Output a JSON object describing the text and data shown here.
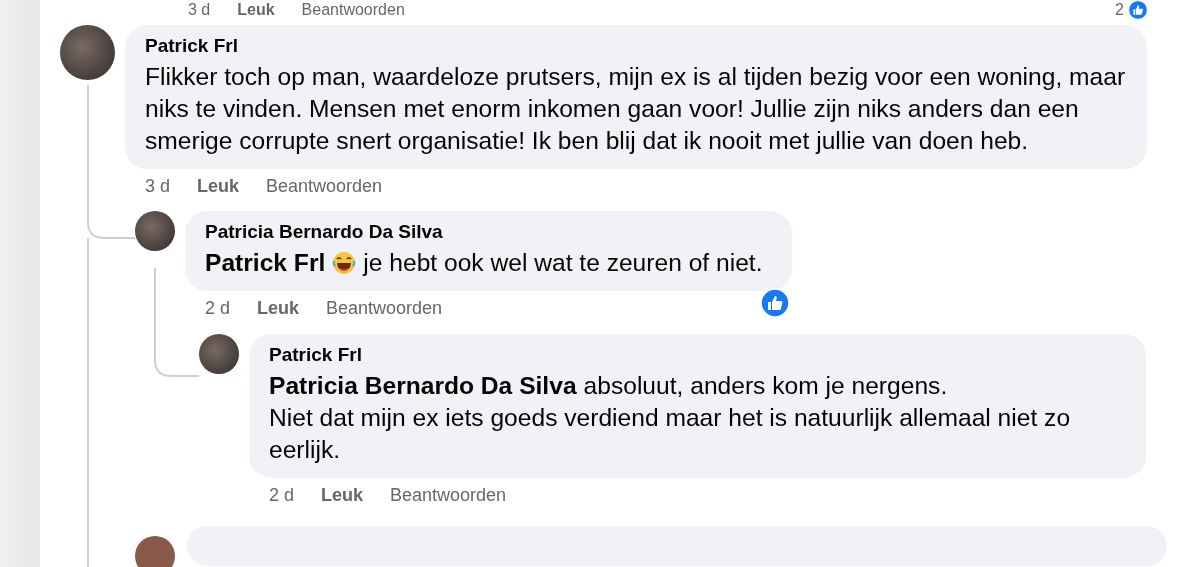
{
  "previous_actions": {
    "time": "3 d",
    "like": "Leuk",
    "reply": "Beantwoorden",
    "reaction_count": "2"
  },
  "comments": [
    {
      "author": "Patrick Frl",
      "emoji": false,
      "paragraphs": [
        "Flikker toch op man, waardeloze prutsers, mijn ex is al tijden bezig voor een woning, maar niks te vinden. Mensen met enorm inkomen gaan voor! Jullie zijn niks anders dan een smerige corrupte snert organisatie! Ik ben blij dat ik nooit met jullie van doen heb."
      ],
      "time": "3 d",
      "like": "Leuk",
      "reply": "Beantwoorden",
      "liked": false,
      "replies": [
        {
          "author": "Patricia Bernardo Da Silva",
          "mention": "Patrick Frl",
          "emoji": true,
          "paragraphs": [
            "je hebt ook wel wat te zeuren of niet."
          ],
          "time": "2 d",
          "like": "Leuk",
          "reply": "Beantwoorden",
          "liked": true,
          "replies": [
            {
              "author": "Patrick Frl",
              "mention": "Patricia Bernardo Da Silva",
              "emoji": false,
              "paragraphs": [
                "absoluut, anders kom je nergens.",
                "Niet dat mijn ex iets goeds verdiend maar het is natuurlijk allemaal niet zo eerlijk."
              ],
              "time": "2 d",
              "like": "Leuk",
              "reply": "Beantwoorden",
              "liked": false
            }
          ]
        }
      ]
    }
  ],
  "next_comment": {
    "visible": true
  }
}
